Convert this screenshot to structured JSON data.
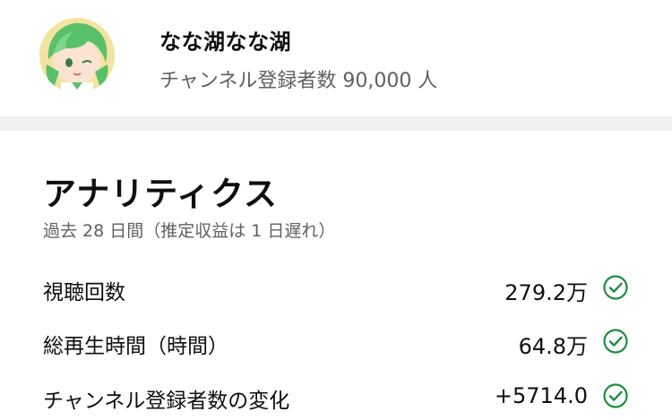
{
  "channel": {
    "name": "なな湖なな湖",
    "subscribers_text": "チャンネル登録者数 90,000 人"
  },
  "analytics": {
    "title": "アナリティクス",
    "subtitle": "過去 28 日間（推定収益は 1 日遅れ）",
    "metrics": [
      {
        "label": "視聴回数",
        "value": "279.2万",
        "icon": "check-circle-icon"
      },
      {
        "label": "総再生時間（時間）",
        "value": "64.8万",
        "icon": "check-circle-icon"
      },
      {
        "label": "チャンネル登録者数の変化",
        "value": "+5714.0",
        "icon": "check-circle-icon"
      }
    ]
  },
  "colors": {
    "check": "#1e8e3e",
    "secondary_text": "#606060",
    "band": "#f0f0f0"
  }
}
